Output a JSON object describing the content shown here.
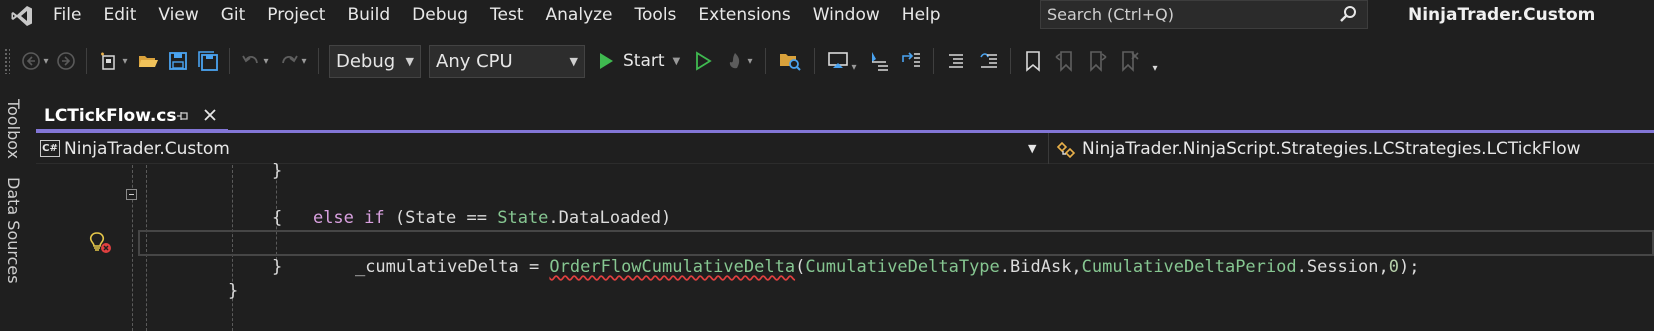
{
  "menubar": {
    "items": [
      "File",
      "Edit",
      "View",
      "Git",
      "Project",
      "Build",
      "Debug",
      "Test",
      "Analyze",
      "Tools",
      "Extensions",
      "Window",
      "Help"
    ],
    "search_placeholder": "Search (Ctrl+Q)",
    "window_title": "NinjaTrader.Custom"
  },
  "toolbar": {
    "configuration": "Debug",
    "platform": "Any CPU",
    "start_label": "Start"
  },
  "left_rail": {
    "toolbox": "Toolbox",
    "data_sources": "Data Sources"
  },
  "tab": {
    "title": "LCTickFlow.cs"
  },
  "navbar": {
    "project_badge": "C#",
    "project": "NinjaTrader.Custom",
    "member": "NinjaTrader.NinjaScript.Strategies.LCStrategies.LCTickFlow"
  },
  "code": {
    "line1": "}",
    "line2_kw1": "else",
    "line2_kw2": "if",
    "line2_text": " (State == ",
    "line2_type": "State",
    "line2_tail": ".DataLoaded)",
    "line3": "{",
    "line4_var": "_cumulativeDelta = ",
    "line4_method": "OrderFlowCumulativeDelta",
    "line4_paren": "(",
    "line4_type1": "CumulativeDeltaType",
    "line4_member1": ".BidAsk,",
    "line4_type2": "CumulativeDeltaPeriod",
    "line4_member2": ".Session,",
    "line4_num": "0",
    "line4_end": ");",
    "line5": "}",
    "line6": "}"
  },
  "colors": {
    "accent": "#8276d6",
    "keyword": "#d8a0df",
    "type": "#86c691",
    "error_squiggle": "#e04040",
    "start_green": "#3fb950"
  }
}
